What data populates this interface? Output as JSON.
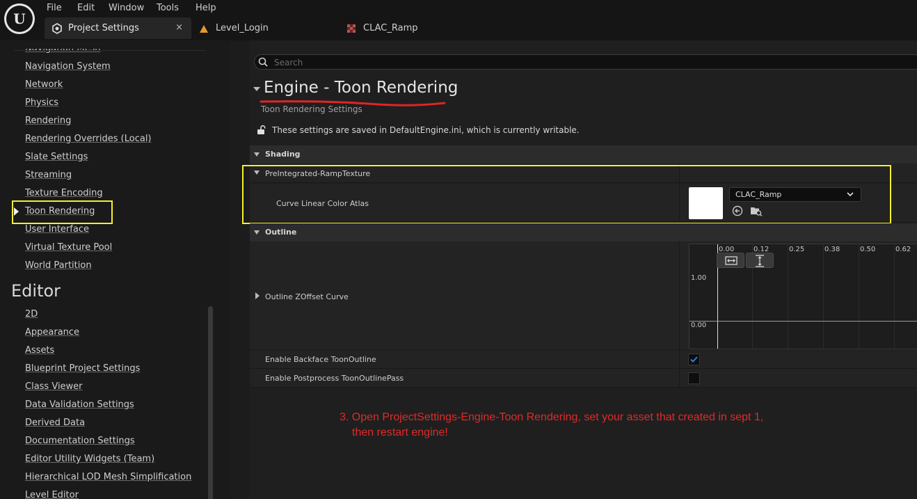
{
  "menu": [
    "File",
    "Edit",
    "Window",
    "Tools",
    "Help"
  ],
  "tabs": [
    {
      "label": "Project Settings",
      "icon": "project-settings-icon",
      "active": true
    },
    {
      "label": "Level_Login",
      "icon": "level-icon",
      "active": false
    },
    {
      "label": "CLAC_Ramp",
      "icon": "texture-asset-icon",
      "active": false
    }
  ],
  "close_glyph": "×",
  "sidebar": {
    "partial_item": "Navigation Mesh",
    "engine_items": [
      "Navigation System",
      "Network",
      "Physics",
      "Rendering",
      "Rendering Overrides (Local)",
      "Slate Settings",
      "Streaming",
      "Texture Encoding",
      "Toon Rendering",
      "User Interface",
      "Virtual Texture Pool",
      "World Partition"
    ],
    "selected": "Toon Rendering",
    "editor_heading": "Editor",
    "editor_items": [
      "2D",
      "Appearance",
      "Assets",
      "Blueprint Project Settings",
      "Class Viewer",
      "Data Validation Settings",
      "Derived Data",
      "Documentation Settings",
      "Editor Utility Widgets (Team)",
      "Hierarchical LOD Mesh Simplification",
      "Level Editor"
    ]
  },
  "search": {
    "placeholder": "Search",
    "value": ""
  },
  "section": {
    "title": "Engine - Toon Rendering",
    "subtitle": "Toon Rendering Settings",
    "ini_notice": "These settings are saved in DefaultEngine.ini, which is currently writable."
  },
  "categories": {
    "shading": "Shading",
    "outline": "Outline"
  },
  "properties": {
    "ramp_group": "PreIntegrated-RampTexture",
    "curve_atlas_label": "Curve Linear Color Atlas",
    "curve_atlas_value": "CLAC_Ramp",
    "outline_curve_label": "Outline ZOffset Curve",
    "backface_label": "Enable Backface ToonOutline",
    "backface_checked": true,
    "postprocess_label": "Enable Postprocess ToonOutlinePass",
    "postprocess_checked": false
  },
  "curve_editor": {
    "x_ticks": [
      "0.00",
      "0.12",
      "0.25",
      "0.38",
      "0.50",
      "0.62"
    ],
    "y_ticks": [
      "1.00",
      "0.00"
    ]
  },
  "annotation": {
    "line1": "3. Open ProjectSettings-Engine-Toon Rendering, set your asset that created in sept 1,",
    "line2": "then restart engine!"
  },
  "colors": {
    "highlight": "#f5f02c",
    "annotation": "#e02a2a",
    "check": "#2b7de0"
  }
}
